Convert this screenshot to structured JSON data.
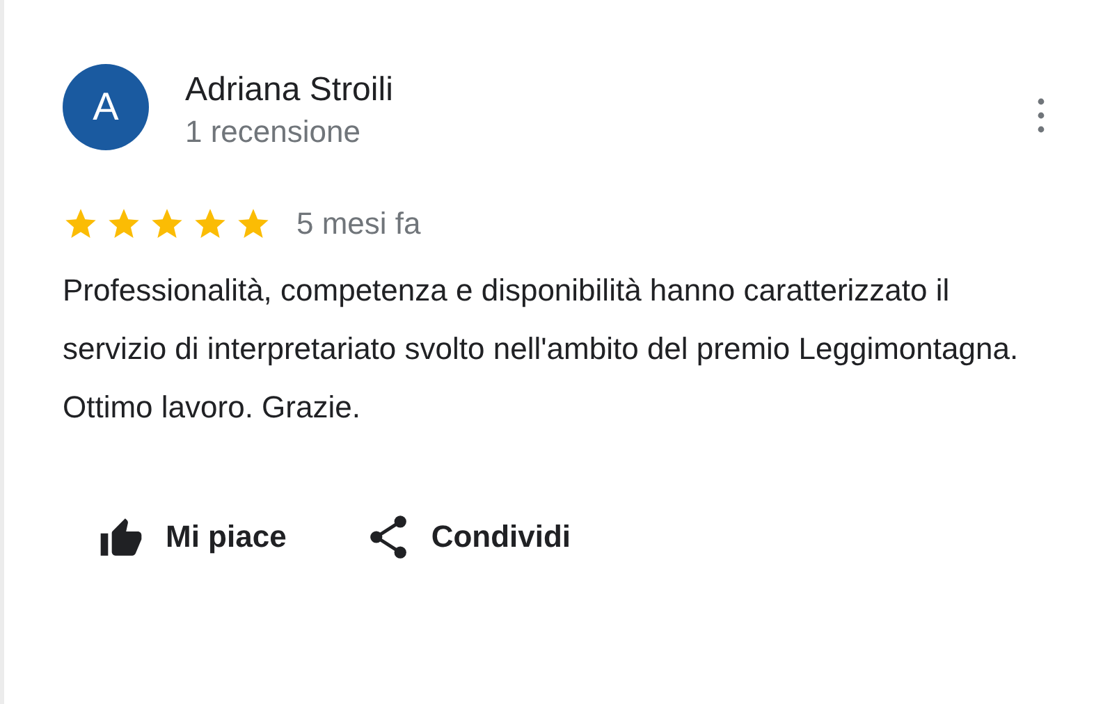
{
  "review": {
    "avatar_letter": "A",
    "author": "Adriana Stroili",
    "author_meta": "1 recensione",
    "stars": 5,
    "time": "5 mesi fa",
    "text": "Professionalità, competenza e disponibilità hanno caratterizzato il servizio di interpretariato svolto nell'ambito del premio Leggimontagna. Ottimo lavoro. Grazie.",
    "actions": [
      {
        "kind": "like",
        "label": "Mi piace"
      },
      {
        "kind": "share",
        "label": "Condividi"
      }
    ]
  }
}
